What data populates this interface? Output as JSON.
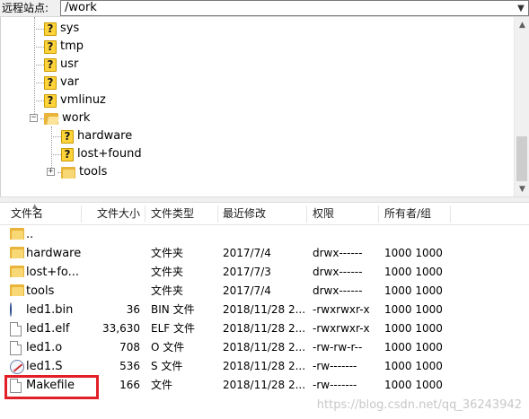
{
  "address_bar": {
    "label": "远程站点:",
    "value": "/work"
  },
  "tree": {
    "items": [
      {
        "label": "sys",
        "icon": "question-icon"
      },
      {
        "label": "tmp",
        "icon": "question-icon"
      },
      {
        "label": "usr",
        "icon": "question-icon"
      },
      {
        "label": "var",
        "icon": "question-icon"
      },
      {
        "label": "vmlinuz",
        "icon": "question-icon"
      },
      {
        "label": "work",
        "icon": "folder-open-icon",
        "expander": "−"
      },
      {
        "label": "hardware",
        "icon": "question-icon"
      },
      {
        "label": "lost+found",
        "icon": "question-icon"
      },
      {
        "label": "tools",
        "icon": "folder-icon",
        "expander": "+"
      }
    ]
  },
  "file_list": {
    "columns": {
      "name": "文件名",
      "size": "文件大小",
      "type": "文件类型",
      "modified": "最近修改",
      "permissions": "权限",
      "owner": "所有者/组"
    },
    "rows": [
      {
        "name": "..",
        "size": "",
        "type": "",
        "modified": "",
        "permissions": "",
        "owner": "",
        "icon": "folder-icon"
      },
      {
        "name": "hardware",
        "size": "",
        "type": "文件夹",
        "modified": "2017/7/4",
        "permissions": "drwx------",
        "owner": "1000 1000",
        "icon": "folder-icon"
      },
      {
        "name": "lost+fo...",
        "size": "",
        "type": "文件夹",
        "modified": "2017/7/3",
        "permissions": "drwx------",
        "owner": "1000 1000",
        "icon": "folder-icon"
      },
      {
        "name": "tools",
        "size": "",
        "type": "文件夹",
        "modified": "2017/7/4",
        "permissions": "drwx------",
        "owner": "1000 1000",
        "icon": "folder-icon"
      },
      {
        "name": "led1.bin",
        "size": "36",
        "type": "BIN 文件",
        "modified": "2018/11/28 2...",
        "permissions": "-rwxrwxr-x",
        "owner": "1000 1000",
        "icon": "bin-file-icon"
      },
      {
        "name": "led1.elf",
        "size": "33,630",
        "type": "ELF 文件",
        "modified": "2018/11/28 2...",
        "permissions": "-rwxrwxr-x",
        "owner": "1000 1000",
        "icon": "file-icon"
      },
      {
        "name": "led1.o",
        "size": "708",
        "type": "O 文件",
        "modified": "2018/11/28 2...",
        "permissions": "-rw-rw-r--",
        "owner": "1000 1000",
        "icon": "file-icon"
      },
      {
        "name": "led1.S",
        "size": "536",
        "type": "S 文件",
        "modified": "2018/11/28 2...",
        "permissions": "-rw-------",
        "owner": "1000 1000",
        "icon": "s-file-icon"
      },
      {
        "name": "Makefile",
        "size": "166",
        "type": "文件",
        "modified": "2018/11/28 2...",
        "permissions": "-rw-------",
        "owner": "1000 1000",
        "icon": "file-icon"
      }
    ]
  },
  "colors": {
    "highlight": "#e11f27"
  },
  "watermark": "https://blog.csdn.net/qq_36243942"
}
